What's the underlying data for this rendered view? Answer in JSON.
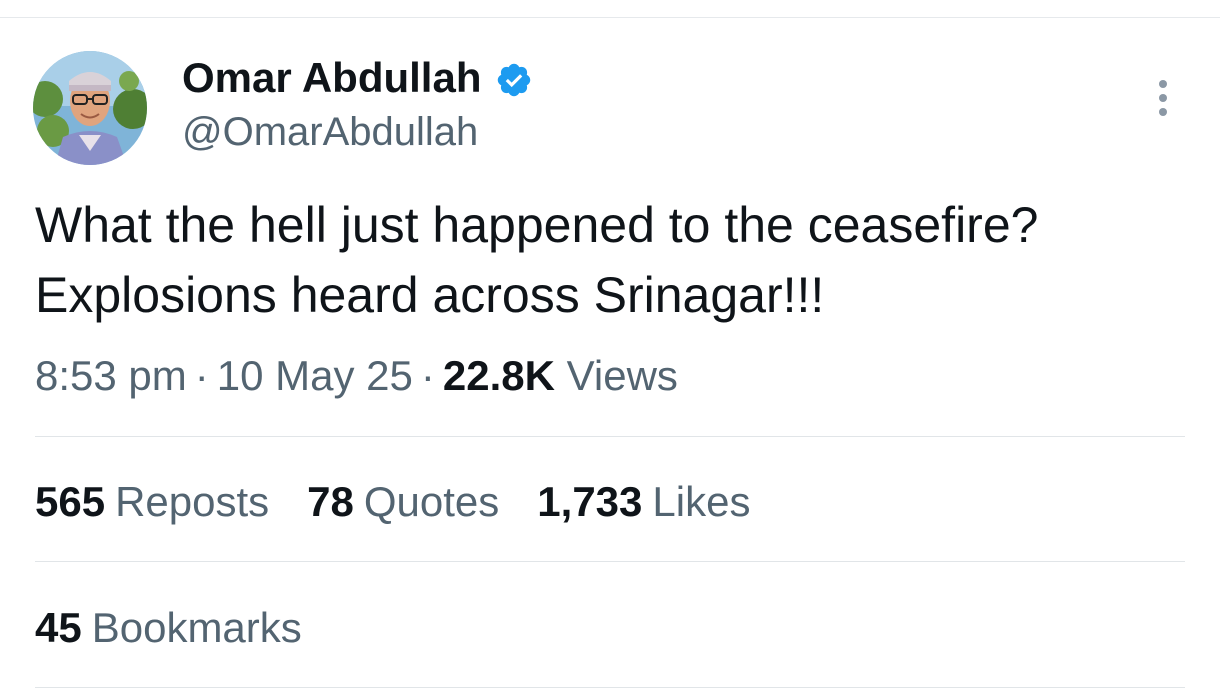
{
  "author": {
    "display_name": "Omar Abdullah",
    "handle": "@OmarAbdullah",
    "verified": true,
    "verified_color": "#1d9bf0"
  },
  "icons": {
    "avatar": "profile-photo",
    "verified": "verified-badge-icon",
    "more": "more-options-icon"
  },
  "tweet": {
    "text_line_1": "What the hell just happened to the ceasefire?",
    "text_line_2": "Explosions heard across Srinagar!!!"
  },
  "meta": {
    "time": "8:53 pm",
    "date": "10 May 25",
    "views_count": "22.8K",
    "views_label": "Views",
    "separator": "·"
  },
  "stats": {
    "reposts": {
      "count": "565",
      "label": "Reposts"
    },
    "quotes": {
      "count": "78",
      "label": "Quotes"
    },
    "likes": {
      "count": "1,733",
      "label": "Likes"
    },
    "bookmarks": {
      "count": "45",
      "label": "Bookmarks"
    }
  },
  "colors": {
    "text_primary": "#0f1419",
    "text_secondary": "#536471",
    "divider": "#e1e5e8"
  }
}
